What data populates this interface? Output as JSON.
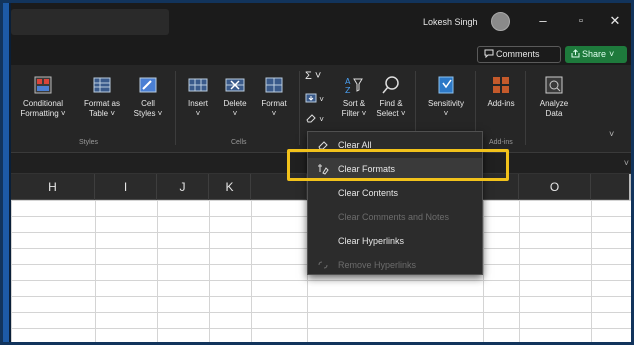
{
  "titlebar": {
    "user_name": "Lokesh Singh",
    "minimize": "–",
    "maximize": "▫",
    "close": "✕"
  },
  "sharebar": {
    "comments_label": "Comments",
    "share_label": "Share"
  },
  "ribbon": {
    "styles": {
      "conditional_formatting": [
        "Conditional",
        "Formatting ˅"
      ],
      "format_as_table": [
        "Format as",
        "Table ˅"
      ],
      "cell_styles": [
        "Cell",
        "Styles ˅"
      ],
      "group_label": "Styles"
    },
    "cells": {
      "insert": "Insert",
      "delete": "Delete",
      "format": "Format",
      "group_label": "Cells"
    },
    "editing": {
      "autosum": "Σ ˅",
      "fill": "˅",
      "clear": "˅",
      "sort_filter": [
        "Sort &",
        "Filter ˅"
      ],
      "find_select": [
        "Find &",
        "Select ˅"
      ]
    },
    "sensitivity": "Sensitivity",
    "addins": {
      "label": "Add-ins",
      "group_label": "Add-ins"
    },
    "analyze_data": [
      "Analyze",
      "Data"
    ]
  },
  "columns": [
    "H",
    "I",
    "J",
    "K",
    "O"
  ],
  "clear_menu": {
    "items": [
      {
        "label": "Clear All",
        "enabled": true
      },
      {
        "label": "Clear Formats",
        "enabled": true,
        "highlighted": true
      },
      {
        "label": "Clear Contents",
        "enabled": true
      },
      {
        "label": "Clear Comments and Notes",
        "enabled": false
      },
      {
        "label": "Clear Hyperlinks",
        "enabled": true
      },
      {
        "label": "Remove Hyperlinks",
        "enabled": false
      }
    ]
  },
  "colors": {
    "highlight_border": "#f2c21b",
    "share_green": "#1e7a3c"
  }
}
